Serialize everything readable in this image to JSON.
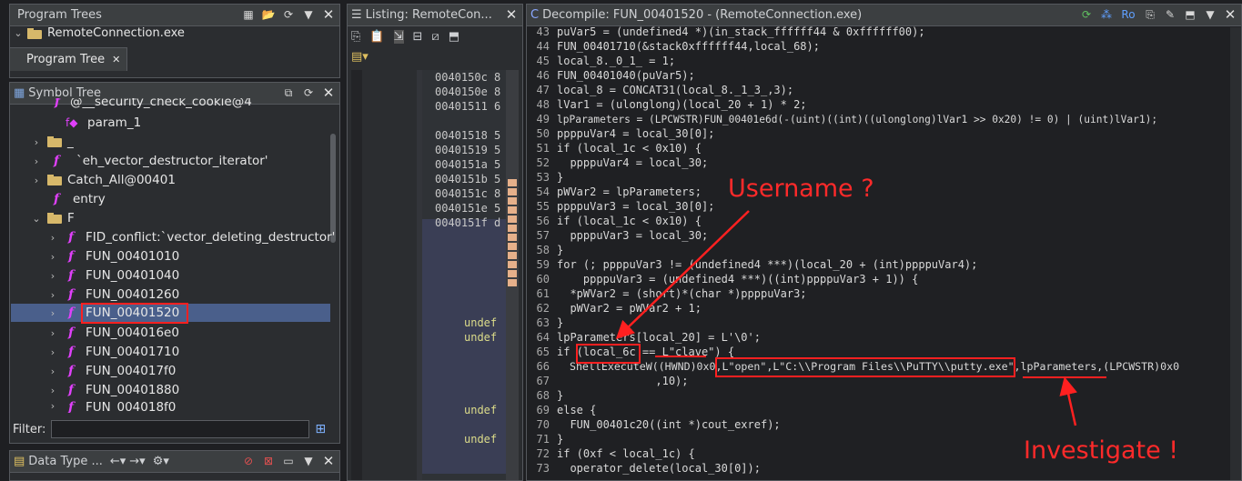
{
  "program_trees": {
    "title": "Program Trees",
    "root": "RemoteConnection.exe",
    "tab_label": "Program Tree"
  },
  "symbol_tree": {
    "title": "Symbol Tree",
    "items": [
      {
        "label": "@__security_check_cookie@4",
        "icon": "function-icon"
      },
      {
        "label": "param_1",
        "icon": "parameter-icon"
      },
      {
        "label": "_",
        "icon": "folder-icon"
      },
      {
        "label": "`eh_vector_destructor_iterator'",
        "icon": "function-icon"
      },
      {
        "label": "Catch_All@00401",
        "icon": "folder-icon"
      },
      {
        "label": "entry",
        "icon": "function-icon"
      },
      {
        "label": "F",
        "icon": "folder-icon"
      },
      {
        "label": "FID_conflict:`vector_deleting_destructor'",
        "icon": "function-icon"
      },
      {
        "label": "FUN_00401010",
        "icon": "function-icon"
      },
      {
        "label": "FUN_00401040",
        "icon": "function-icon"
      },
      {
        "label": "FUN_00401260",
        "icon": "function-icon"
      },
      {
        "label": "FUN_00401520",
        "icon": "function-icon"
      },
      {
        "label": "FUN_004016e0",
        "icon": "function-icon"
      },
      {
        "label": "FUN_00401710",
        "icon": "function-icon"
      },
      {
        "label": "FUN_004017f0",
        "icon": "function-icon"
      },
      {
        "label": "FUN_00401880",
        "icon": "function-icon"
      },
      {
        "label": "FUN_004018f0",
        "icon": "function-icon"
      }
    ],
    "filter_label": "Filter:",
    "filter_value": ""
  },
  "data_type": {
    "title": "Data Type ..."
  },
  "listing": {
    "title": "Listing:  RemoteCon...",
    "addresses": [
      "0040150c 8",
      "0040150e 8",
      "00401511 6",
      "",
      "00401518 5",
      "00401519 5",
      "0040151a 5",
      "0040151b 5",
      "0040151c 8",
      "0040151e 5",
      "0040151f d"
    ],
    "labels": [
      "undef",
      "undef",
      "undef",
      "undef"
    ]
  },
  "decompile": {
    "title": "Decompile: FUN_00401520 - (RemoteConnection.exe)",
    "lines": [
      {
        "n": "43",
        "t": "puVar5 = (undefined4 *)(in_stack_ffffff44 & 0xffffff00);"
      },
      {
        "n": "44",
        "t": "FUN_00401710(&stack0xffffff44,local_68);"
      },
      {
        "n": "45",
        "t": "local_8._0_1_ = 1;"
      },
      {
        "n": "46",
        "t": "FUN_00401040(puVar5);"
      },
      {
        "n": "47",
        "t": "local_8 = CONCAT31(local_8._1_3_,3);"
      },
      {
        "n": "48",
        "t": "lVar1 = (ulonglong)(local_20 + 1) * 2;"
      },
      {
        "n": "49",
        "t": "lpParameters = (LPCWSTR)FUN_00401e6d(-(uint)((int)((ulonglong)lVar1 >> 0x20) != 0) | (uint)lVar1);"
      },
      {
        "n": "50",
        "t": "ppppuVar4 = local_30[0];"
      },
      {
        "n": "51",
        "t": "if (local_1c < 0x10) {"
      },
      {
        "n": "52",
        "t": "  ppppuVar4 = local_30;"
      },
      {
        "n": "53",
        "t": "}"
      },
      {
        "n": "54",
        "t": "pWVar2 = lpParameters;"
      },
      {
        "n": "55",
        "t": "ppppuVar3 = local_30[0];"
      },
      {
        "n": "56",
        "t": "if (local_1c < 0x10) {"
      },
      {
        "n": "57",
        "t": "  ppppuVar3 = local_30;"
      },
      {
        "n": "58",
        "t": "}"
      },
      {
        "n": "59",
        "t": "for (; ppppuVar3 != (undefined4 ***)(local_20 + (int)ppppuVar4);"
      },
      {
        "n": "60",
        "t": "    ppppuVar3 = (undefined4 ***)((int)ppppuVar3 + 1)) {"
      },
      {
        "n": "61",
        "t": "  *pWVar2 = (short)*(char *)ppppuVar3;"
      },
      {
        "n": "62",
        "t": "  pWVar2 = pWVar2 + 1;"
      },
      {
        "n": "63",
        "t": "}"
      },
      {
        "n": "64",
        "t": "lpParameters[local_20] = L'\\0';"
      },
      {
        "n": "65",
        "t": "if (local_6c == L\"clave\") {"
      },
      {
        "n": "66",
        "t": "  ShellExecuteW((HWND)0x0,L\"open\",L\"C:\\\\Program Files\\\\PuTTY\\\\putty.exe\",lpParameters,(LPCWSTR)0x0"
      },
      {
        "n": "67",
        "t": "               ,10);"
      },
      {
        "n": "68",
        "t": "}"
      },
      {
        "n": "69",
        "t": "else {"
      },
      {
        "n": "70",
        "t": "  FUN_00401c20((int *)cout_exref);"
      },
      {
        "n": "71",
        "t": "}"
      },
      {
        "n": "72",
        "t": "if (0xf < local_1c) {"
      },
      {
        "n": "73",
        "t": "  operator_delete(local_30[0]);"
      }
    ],
    "annotations": {
      "username": "Username ?",
      "investigate": "Investigate !"
    }
  },
  "colors": {
    "annotation": "#ff2020",
    "selection": "#4a5f8b",
    "function_icon": "#e040fb"
  }
}
